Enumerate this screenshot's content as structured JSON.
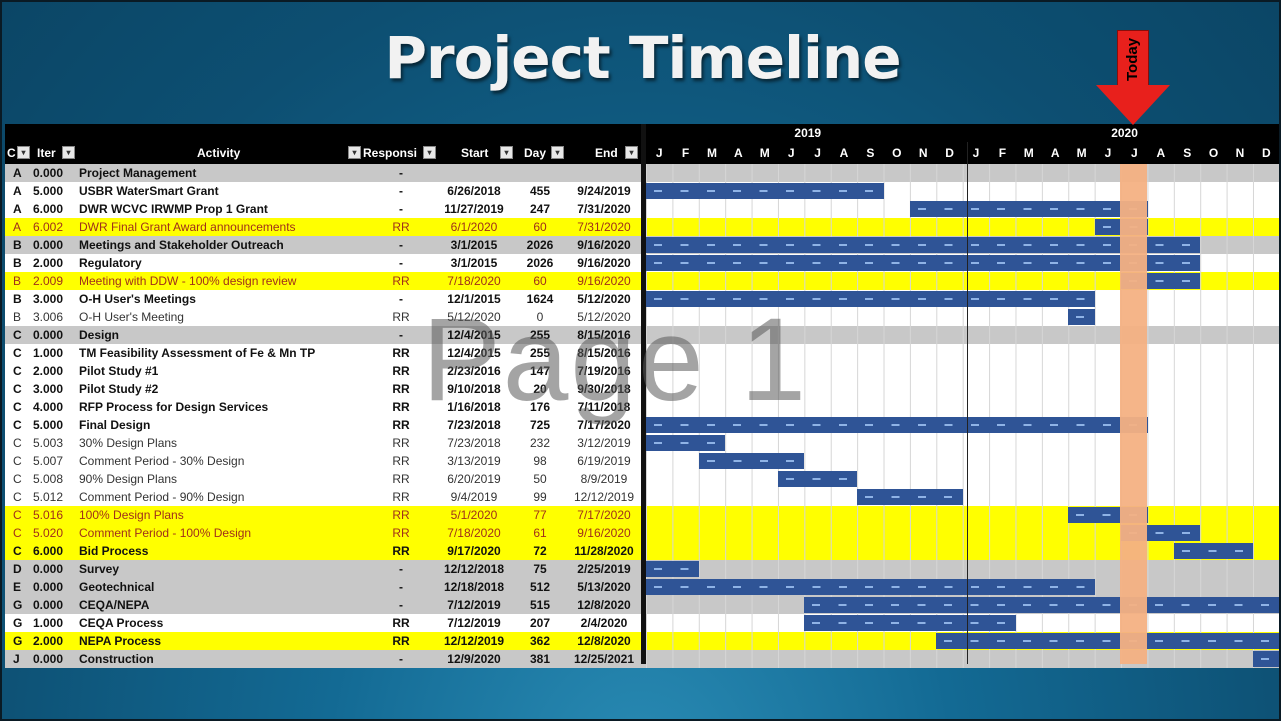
{
  "title": "Project Timeline",
  "today_label": "Today",
  "watermark": "Page 1",
  "years": [
    {
      "label": "2019",
      "month_index": 6
    },
    {
      "label": "2020",
      "month_index": 18
    }
  ],
  "headers": {
    "code": "C",
    "item": "Iter",
    "activity": "Activity",
    "responsible": "Responsi",
    "start": "Start",
    "days": "Day",
    "end": "End"
  },
  "months": [
    "J",
    "F",
    "M",
    "A",
    "M",
    "J",
    "J",
    "A",
    "S",
    "O",
    "N",
    "D",
    "J",
    "F",
    "M",
    "A",
    "M",
    "J",
    "J",
    "A",
    "S",
    "O",
    "N",
    "D"
  ],
  "today_month_index": 18,
  "colors": {
    "bar": "#2f5496",
    "today_column": "#f4b183",
    "highlight": "#ffff00",
    "group_row": "#c8c8c8",
    "arrow": "#e8201c"
  },
  "rows": [
    {
      "code": "A",
      "item": "0.000",
      "activity": "Project Management",
      "resp": "-",
      "start": "",
      "days": "",
      "end": "",
      "style": "gray bold",
      "bars": []
    },
    {
      "code": "A",
      "item": "5.000",
      "activity": "USBR WaterSmart Grant",
      "resp": "-",
      "start": "6/26/2018",
      "days": "455",
      "end": "9/24/2019",
      "style": "white bold",
      "bars": [
        [
          0,
          9
        ]
      ]
    },
    {
      "code": "A",
      "item": "6.000",
      "activity": "DWR WCVC IRWMP Prop 1 Grant",
      "resp": "-",
      "start": "11/27/2019",
      "days": "247",
      "end": "7/31/2020",
      "style": "white bold",
      "bars": [
        [
          10,
          19
        ]
      ]
    },
    {
      "code": "A",
      "item": "6.002",
      "activity": "DWR Final Grant Award announcements",
      "resp": "RR",
      "start": "6/1/2020",
      "days": "60",
      "end": "7/31/2020",
      "style": "yellow light",
      "bars": [
        [
          17,
          19
        ]
      ]
    },
    {
      "code": "B",
      "item": "0.000",
      "activity": "Meetings and Stakeholder Outreach",
      "resp": "-",
      "start": "3/1/2015",
      "days": "2026",
      "end": "9/16/2020",
      "style": "gray bold",
      "bars": [
        [
          0,
          21
        ]
      ]
    },
    {
      "code": "B",
      "item": "2.000",
      "activity": "Regulatory",
      "resp": "-",
      "start": "3/1/2015",
      "days": "2026",
      "end": "9/16/2020",
      "style": "white bold",
      "bars": [
        [
          0,
          21
        ]
      ]
    },
    {
      "code": "B",
      "item": "2.009",
      "activity": "Meeting with DDW - 100% design review",
      "resp": "RR",
      "start": "7/18/2020",
      "days": "60",
      "end": "9/16/2020",
      "style": "yellow light",
      "bars": [
        [
          18,
          21
        ]
      ]
    },
    {
      "code": "B",
      "item": "3.000",
      "activity": "O-H User's Meetings",
      "resp": "-",
      "start": "12/1/2015",
      "days": "1624",
      "end": "5/12/2020",
      "style": "white bold",
      "bars": [
        [
          0,
          17
        ]
      ]
    },
    {
      "code": "B",
      "item": "3.006",
      "activity": "O-H User's Meeting",
      "resp": "RR",
      "start": "5/12/2020",
      "days": "0",
      "end": "5/12/2020",
      "style": "white light",
      "bars": [
        [
          16,
          17
        ]
      ]
    },
    {
      "code": "C",
      "item": "0.000",
      "activity": "Design",
      "resp": "-",
      "start": "12/4/2015",
      "days": "255",
      "end": "8/15/2016",
      "style": "gray bold",
      "bars": []
    },
    {
      "code": "C",
      "item": "1.000",
      "activity": "TM Feasibility Assessment of Fe & Mn TP",
      "resp": "RR",
      "start": "12/4/2015",
      "days": "255",
      "end": "8/15/2016",
      "style": "white bold",
      "bars": []
    },
    {
      "code": "C",
      "item": "2.000",
      "activity": "Pilot Study #1",
      "resp": "RR",
      "start": "2/23/2016",
      "days": "147",
      "end": "7/19/2016",
      "style": "white bold",
      "bars": []
    },
    {
      "code": "C",
      "item": "3.000",
      "activity": "Pilot Study #2",
      "resp": "RR",
      "start": "9/10/2018",
      "days": "20",
      "end": "9/30/2018",
      "style": "white bold",
      "bars": []
    },
    {
      "code": "C",
      "item": "4.000",
      "activity": "RFP Process for Design Services",
      "resp": "RR",
      "start": "1/16/2018",
      "days": "176",
      "end": "7/11/2018",
      "style": "white bold",
      "bars": []
    },
    {
      "code": "C",
      "item": "5.000",
      "activity": "Final Design",
      "resp": "RR",
      "start": "7/23/2018",
      "days": "725",
      "end": "7/17/2020",
      "style": "white bold",
      "bars": [
        [
          0,
          19
        ]
      ]
    },
    {
      "code": "C",
      "item": "5.003",
      "activity": "30% Design Plans",
      "resp": "RR",
      "start": "7/23/2018",
      "days": "232",
      "end": "3/12/2019",
      "style": "white light",
      "bars": [
        [
          0,
          3
        ]
      ]
    },
    {
      "code": "C",
      "item": "5.007",
      "activity": "Comment Period - 30% Design",
      "resp": "RR",
      "start": "3/13/2019",
      "days": "98",
      "end": "6/19/2019",
      "style": "white light",
      "bars": [
        [
          2,
          6
        ]
      ]
    },
    {
      "code": "C",
      "item": "5.008",
      "activity": "90% Design Plans",
      "resp": "RR",
      "start": "6/20/2019",
      "days": "50",
      "end": "8/9/2019",
      "style": "white light",
      "bars": [
        [
          5,
          8
        ]
      ]
    },
    {
      "code": "C",
      "item": "5.012",
      "activity": "Comment Period - 90% Design",
      "resp": "RR",
      "start": "9/4/2019",
      "days": "99",
      "end": "12/12/2019",
      "style": "white light",
      "bars": [
        [
          8,
          12
        ]
      ]
    },
    {
      "code": "C",
      "item": "5.016",
      "activity": "100% Design Plans",
      "resp": "RR",
      "start": "5/1/2020",
      "days": "77",
      "end": "7/17/2020",
      "style": "yellow light",
      "bars": [
        [
          16,
          19
        ]
      ]
    },
    {
      "code": "C",
      "item": "5.020",
      "activity": "Comment Period - 100% Design",
      "resp": "RR",
      "start": "7/18/2020",
      "days": "61",
      "end": "9/16/2020",
      "style": "yellow light",
      "bars": [
        [
          18,
          21
        ]
      ]
    },
    {
      "code": "C",
      "item": "6.000",
      "activity": "Bid Process",
      "resp": "RR",
      "start": "9/17/2020",
      "days": "72",
      "end": "11/28/2020",
      "style": "yellow bold",
      "bars": [
        [
          20,
          23
        ]
      ]
    },
    {
      "code": "D",
      "item": "0.000",
      "activity": "Survey",
      "resp": "-",
      "start": "12/12/2018",
      "days": "75",
      "end": "2/25/2019",
      "style": "gray bold",
      "bars": [
        [
          0,
          2
        ]
      ]
    },
    {
      "code": "E",
      "item": "0.000",
      "activity": "Geotechnical",
      "resp": "-",
      "start": "12/18/2018",
      "days": "512",
      "end": "5/13/2020",
      "style": "gray bold",
      "bars": [
        [
          0,
          17
        ]
      ]
    },
    {
      "code": "G",
      "item": "0.000",
      "activity": "CEQA/NEPA",
      "resp": "-",
      "start": "7/12/2019",
      "days": "515",
      "end": "12/8/2020",
      "style": "gray bold",
      "bars": [
        [
          6,
          24
        ]
      ]
    },
    {
      "code": "G",
      "item": "1.000",
      "activity": "CEQA Process",
      "resp": "RR",
      "start": "7/12/2019",
      "days": "207",
      "end": "2/4/2020",
      "style": "white bold",
      "bars": [
        [
          6,
          14
        ]
      ]
    },
    {
      "code": "G",
      "item": "2.000",
      "activity": "NEPA Process",
      "resp": "RR",
      "start": "12/12/2019",
      "days": "362",
      "end": "12/8/2020",
      "style": "yellow bold",
      "bars": [
        [
          11,
          24
        ]
      ]
    },
    {
      "code": "J",
      "item": "0.000",
      "activity": "Construction",
      "resp": "-",
      "start": "12/9/2020",
      "days": "381",
      "end": "12/25/2021",
      "style": "gray bold",
      "bars": [
        [
          23,
          24
        ]
      ]
    }
  ]
}
